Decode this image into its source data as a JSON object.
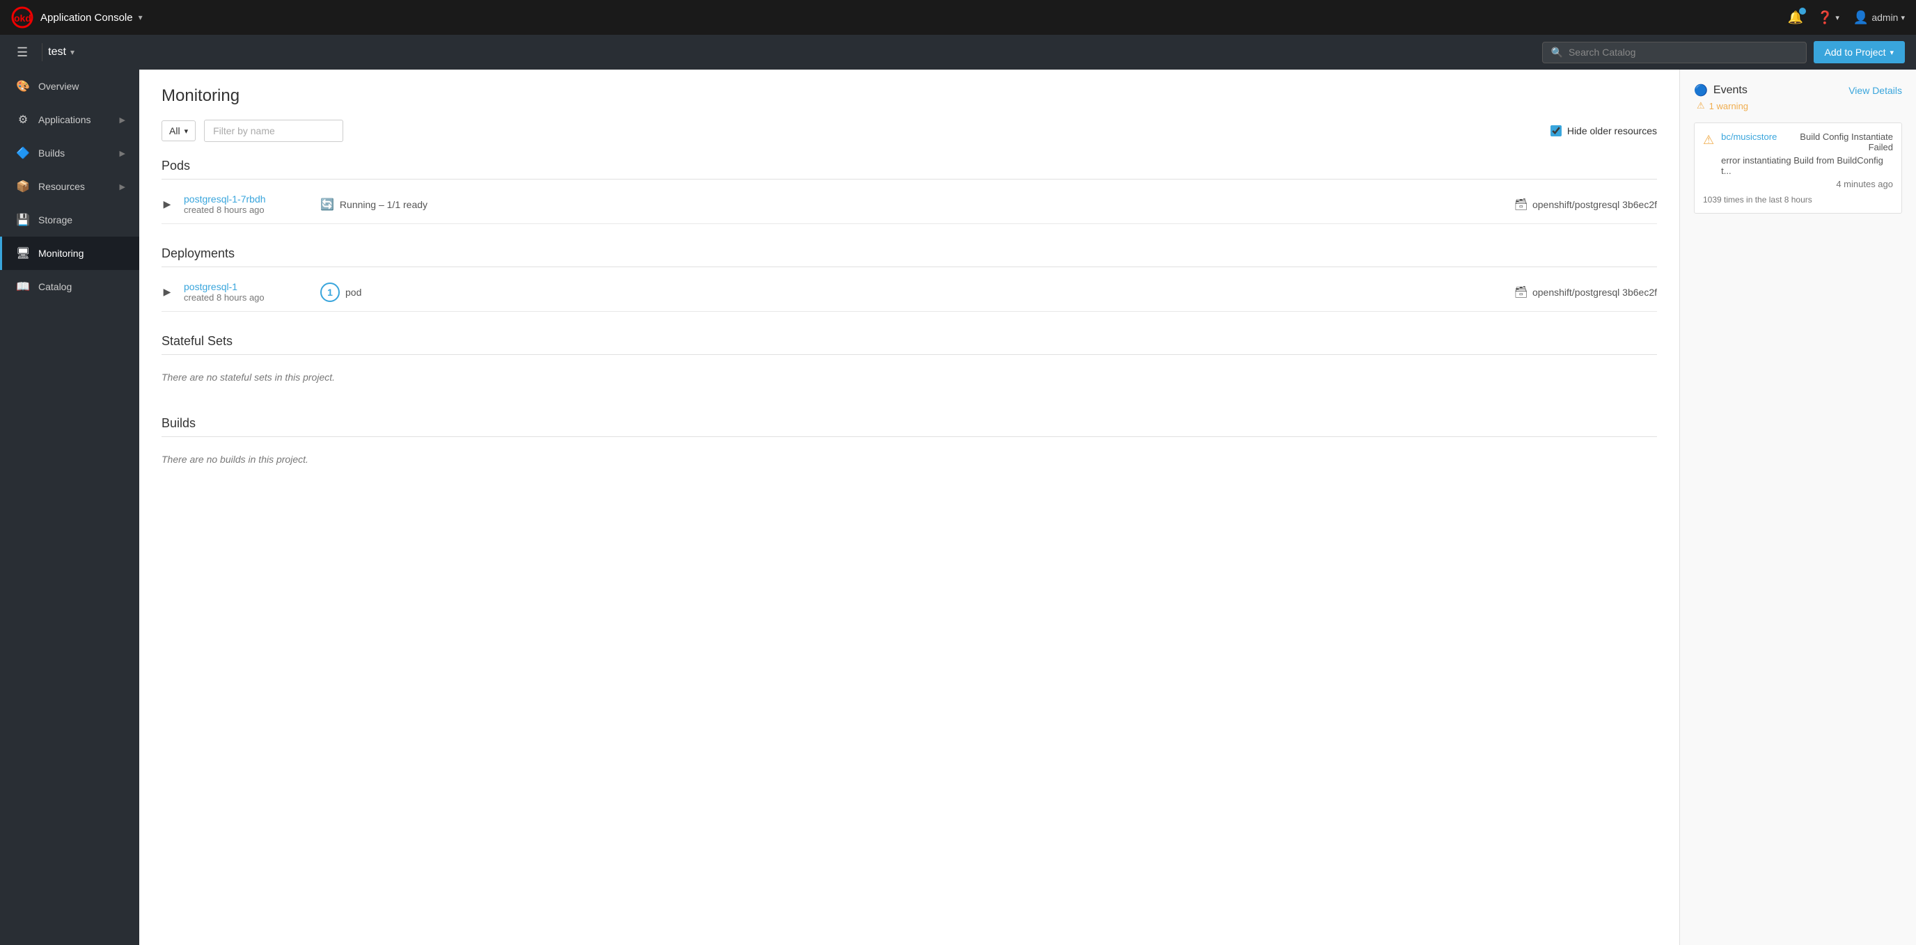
{
  "navbar": {
    "logo_text": "okd",
    "console_label": "Application Console",
    "chevron": "▾",
    "help_label": "?",
    "user_label": "admin",
    "user_chevron": "▾"
  },
  "sub_header": {
    "project_name": "test",
    "project_chevron": "▾",
    "search_placeholder": "Search Catalog",
    "add_to_project_label": "Add to Project",
    "add_to_project_chevron": "▾"
  },
  "sidebar": {
    "items": [
      {
        "id": "overview",
        "label": "Overview",
        "icon": "🎨",
        "has_chevron": false
      },
      {
        "id": "applications",
        "label": "Applications",
        "icon": "⚙",
        "has_chevron": true
      },
      {
        "id": "builds",
        "label": "Builds",
        "icon": "🔷",
        "has_chevron": true
      },
      {
        "id": "resources",
        "label": "Resources",
        "icon": "📦",
        "has_chevron": true
      },
      {
        "id": "storage",
        "label": "Storage",
        "icon": "💾",
        "has_chevron": false
      },
      {
        "id": "monitoring",
        "label": "Monitoring",
        "icon": "🖥",
        "has_chevron": false,
        "active": true
      },
      {
        "id": "catalog",
        "label": "Catalog",
        "icon": "📖",
        "has_chevron": false
      }
    ]
  },
  "monitoring": {
    "page_title": "Monitoring",
    "filter": {
      "select_value": "All",
      "filter_placeholder": "Filter by name",
      "hide_older_label": "Hide older resources",
      "hide_older_checked": true
    },
    "pods": {
      "section_title": "Pods",
      "items": [
        {
          "name": "postgresql-1-7rbdh",
          "created": "created 8 hours ago",
          "status": "Running – 1/1 ready",
          "image": "openshift/postgresql 3b6ec2f"
        }
      ]
    },
    "deployments": {
      "section_title": "Deployments",
      "items": [
        {
          "name": "postgresql-1",
          "created": "created 8 hours ago",
          "pod_count": "1",
          "pod_label": "pod",
          "image": "openshift/postgresql 3b6ec2f"
        }
      ]
    },
    "stateful_sets": {
      "section_title": "Stateful Sets",
      "empty_message": "There are no stateful sets in this project."
    },
    "builds": {
      "section_title": "Builds",
      "empty_message": "There are no builds in this project."
    }
  },
  "events_panel": {
    "title": "Events",
    "view_details_label": "View Details",
    "warning_count": "1 warning",
    "event": {
      "source_link": "bc/musicstore",
      "action": "Build Config Instantiate Failed",
      "description": "error instantiating Build from BuildConfig t...",
      "time": "4 minutes ago",
      "footer": "1039 times in the last 8 hours"
    }
  }
}
